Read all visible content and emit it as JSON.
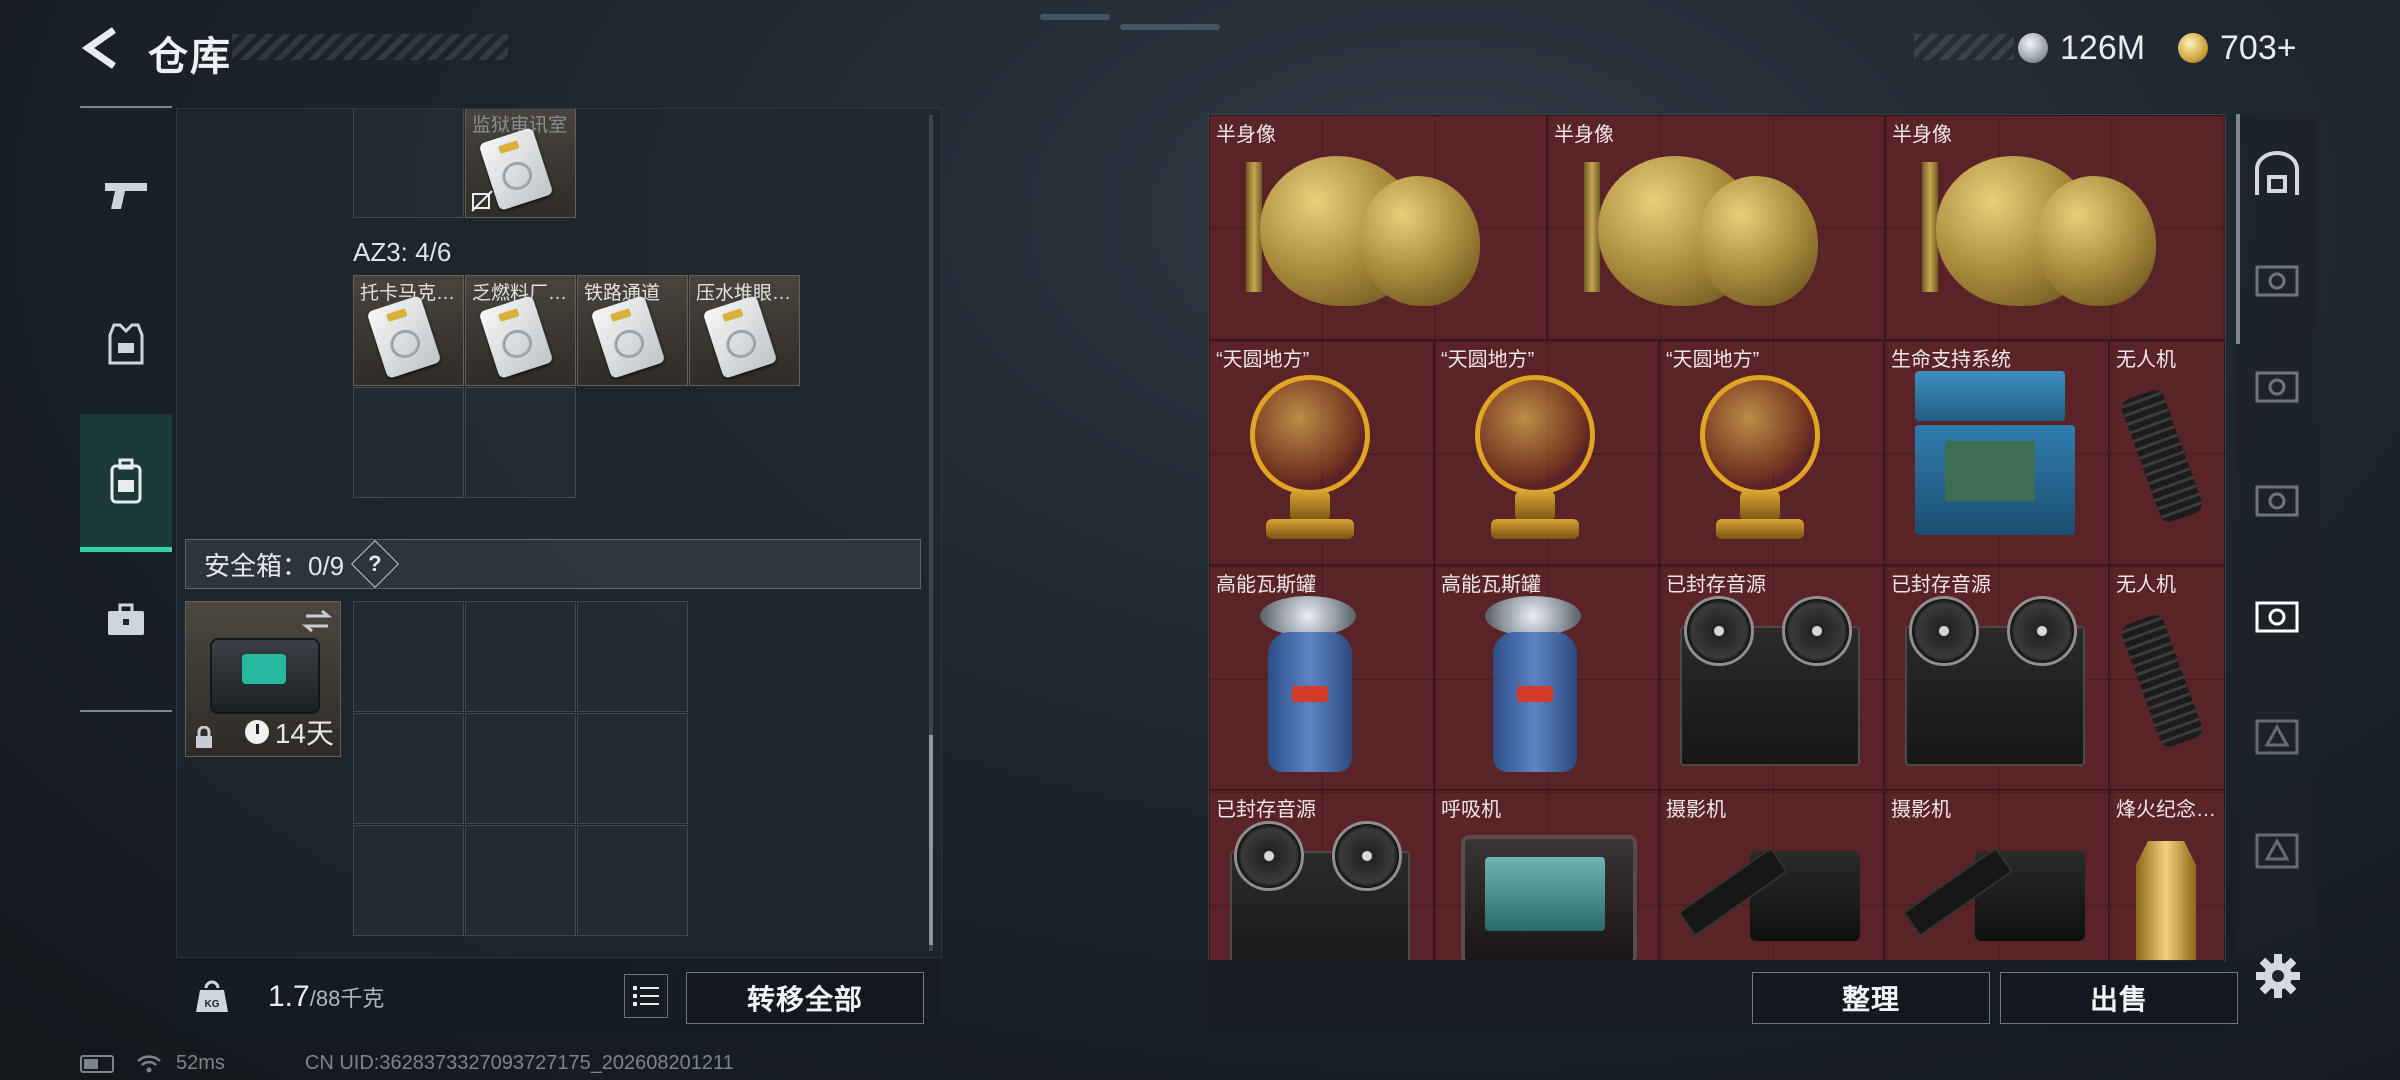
{
  "header": {
    "title": "仓库",
    "currency_silver": "126M",
    "currency_gold": "703+"
  },
  "sidebar": {
    "tabs": [
      {
        "icon": "gun-icon"
      },
      {
        "icon": "armor-vest-icon"
      },
      {
        "icon": "backpack-icon",
        "active": true
      },
      {
        "icon": "toolbox-icon"
      }
    ]
  },
  "left_panel": {
    "top_item": {
      "name": "监狱审讯室"
    },
    "az3": {
      "label": "AZ3: 4/6",
      "items": [
        {
          "name": "托卡马克…"
        },
        {
          "name": "乏燃料厂…"
        },
        {
          "name": "铁路通道"
        },
        {
          "name": "压水堆眼…"
        }
      ]
    },
    "safe_box": {
      "label": "安全箱：0/9",
      "help": "?",
      "days": "14天"
    },
    "weight": {
      "current": "1.7",
      "max": "/88千克"
    },
    "transfer_all": "转移全部"
  },
  "right_panel": {
    "items": [
      {
        "name": "半身像"
      },
      {
        "name": "半身像"
      },
      {
        "name": "半身像"
      },
      {
        "name": "“天圆地方”"
      },
      {
        "name": "“天圆地方”"
      },
      {
        "name": "“天圆地方”"
      },
      {
        "name": "生命支持系统"
      },
      {
        "name": "无人机"
      },
      {
        "name": "高能瓦斯罐"
      },
      {
        "name": "高能瓦斯罐"
      },
      {
        "name": "已封存音源"
      },
      {
        "name": "已封存音源"
      },
      {
        "name": "无人机"
      },
      {
        "name": "已封存音源"
      },
      {
        "name": "呼吸机"
      },
      {
        "name": "摄影机"
      },
      {
        "name": "摄影机"
      },
      {
        "name": "烽火纪念…"
      }
    ],
    "sort": "整理",
    "sell": "出售"
  },
  "status": {
    "ping": "52ms",
    "uid": "CN UID:3628373327093727175_202608201211"
  },
  "colors": {
    "accent": "#2fd6a8",
    "item_bg_red": "#5a2328"
  }
}
